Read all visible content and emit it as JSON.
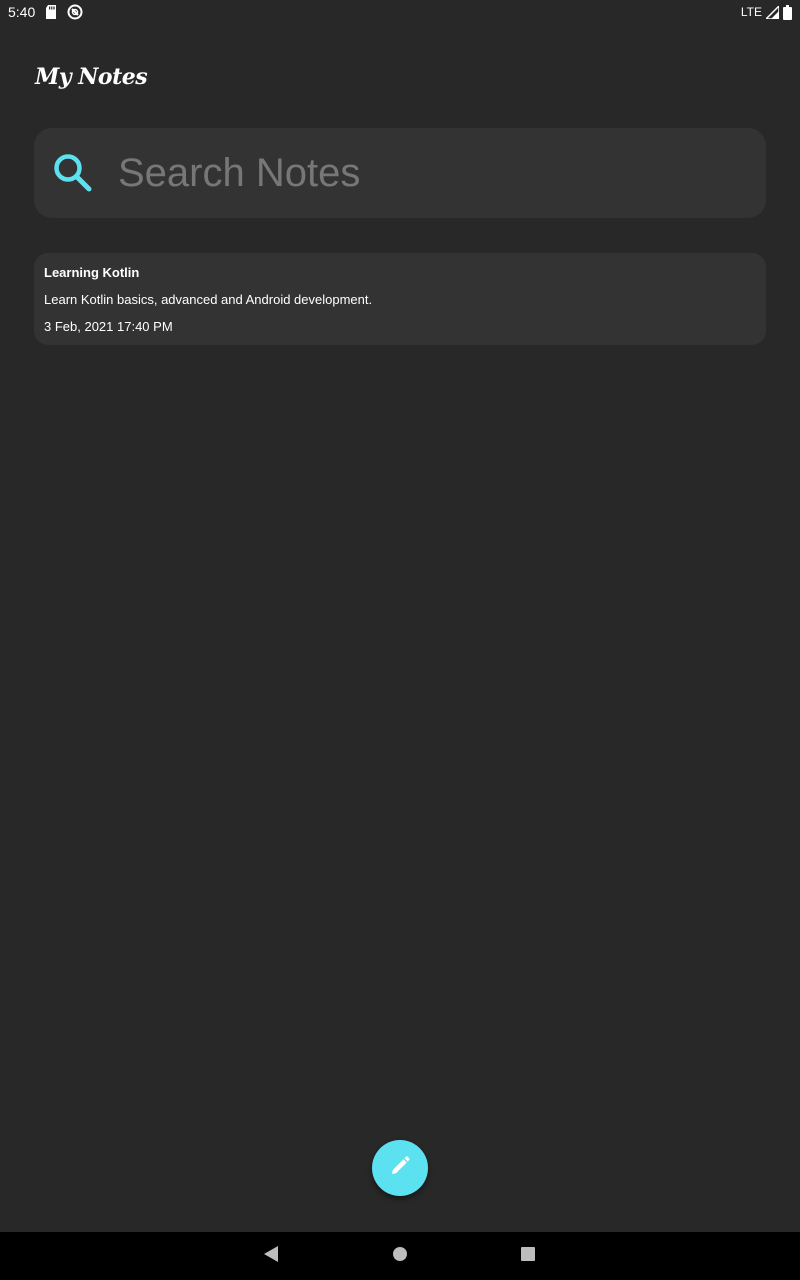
{
  "status_bar": {
    "time": "5:40",
    "network": "LTE",
    "icons": [
      "sd-card-icon",
      "sync-icon",
      "signal-icon",
      "battery-icon"
    ]
  },
  "app": {
    "title": "My Notes"
  },
  "search": {
    "placeholder": "Search Notes",
    "value": "",
    "icon": "search-icon"
  },
  "notes": [
    {
      "title": "Learning Kotlin",
      "body": "Learn Kotlin basics, advanced and Android development.",
      "date": "3 Feb, 2021 17:40 PM"
    }
  ],
  "fab": {
    "icon": "pencil-icon"
  },
  "nav_bar": {
    "icons": [
      "back-icon",
      "home-icon",
      "recents-icon"
    ]
  },
  "colors": {
    "background": "#282828",
    "surface": "#333333",
    "accent": "#5ce1f0",
    "placeholder": "#777777"
  }
}
